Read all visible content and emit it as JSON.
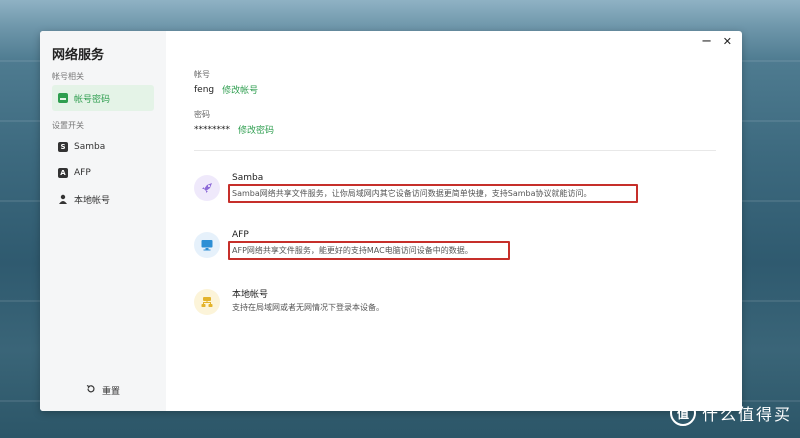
{
  "sidebar": {
    "title": "网络服务",
    "groups": [
      {
        "label": "帐号相关"
      },
      {
        "label": "设置开关"
      }
    ],
    "items": [
      {
        "label": "帐号密码",
        "icon": "id-card-icon",
        "active": true
      },
      {
        "label": "Samba",
        "icon": "samba-icon",
        "active": false
      },
      {
        "label": "AFP",
        "icon": "afp-icon",
        "active": false
      },
      {
        "label": "本地帐号",
        "icon": "user-icon",
        "active": false
      }
    ],
    "reset_label": "重置"
  },
  "account": {
    "username_label": "帐号",
    "username_value": "feng",
    "username_action": "修改帐号",
    "password_label": "密码",
    "password_value": "********",
    "password_action": "修改密码"
  },
  "services": [
    {
      "name": "Samba",
      "description": "Samba网络共享文件服务，让你局域网内其它设备访问数据更简单快捷，支持Samba协议就能访问。",
      "icon": "rocket-icon",
      "color": "#8e6bd8"
    },
    {
      "name": "AFP",
      "description": "AFP网络共享文件服务，能更好的支持MAC电脑访问设备中的数据。",
      "icon": "monitor-icon",
      "color": "#2d8fd5"
    },
    {
      "name": "本地帐号",
      "description": "支持在局域网或者无网情况下登录本设备。",
      "icon": "network-icon",
      "color": "#e3b32b"
    }
  ],
  "window_controls": {
    "minimize": "−",
    "close": "✕"
  },
  "watermark": {
    "logo": "值",
    "text": "什么值得买"
  },
  "colors": {
    "accent": "#2e9e4f",
    "highlight": "#c62f2a"
  }
}
